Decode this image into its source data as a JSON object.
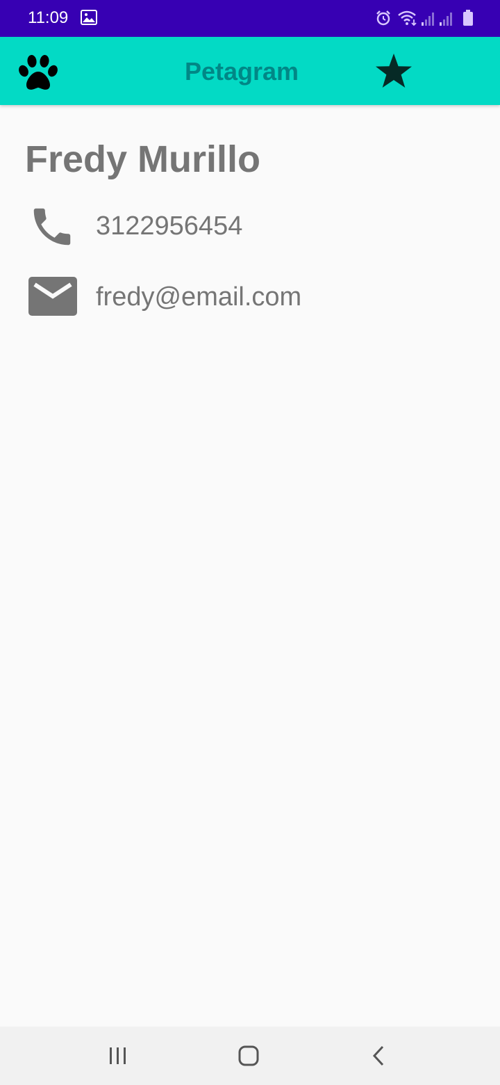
{
  "status_bar": {
    "time": "11:09",
    "icons": [
      "gallery-icon",
      "alarm-icon",
      "wifi-icon",
      "signal-icon",
      "signal-icon",
      "battery-icon"
    ],
    "background": "#3700b3"
  },
  "app_bar": {
    "title": "Petagram",
    "background": "#03dac5",
    "title_color": "#018786",
    "left_icon": "paw-icon",
    "right_icon": "star-icon"
  },
  "contact": {
    "name": "Fredy Murillo",
    "phone": "3122956454",
    "email": "fredy@email.com",
    "text_color": "#757575"
  },
  "nav_bar": {
    "buttons": [
      "recent-apps-icon",
      "home-icon",
      "back-icon"
    ]
  }
}
